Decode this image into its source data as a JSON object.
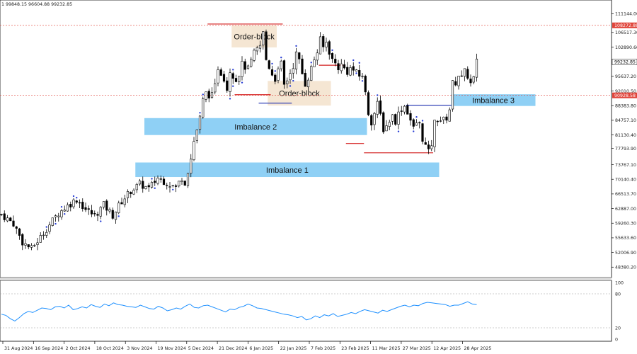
{
  "header": {
    "ohlc_text": "1  99848.15 96604.88 99232.85"
  },
  "chart_data": {
    "type": "candlestick",
    "main_pane": {
      "ylim": [
        46500,
        112800
      ],
      "y_ticks": [
        "111144.00",
        "106517.30",
        "102890.60",
        "95637.20",
        "92010.50",
        "88383.80",
        "84757.10",
        "81130.40",
        "77793.90",
        "73767.10",
        "70140.40",
        "66513.70",
        "62887.00",
        "59260.30",
        "55633.60",
        "52006.90",
        "48380.20"
      ],
      "price_markers": [
        {
          "label": "108272.88",
          "value": 108272.88,
          "color": "#e0443a"
        },
        {
          "label": "99232.85",
          "value": 99232.85,
          "color": "#ffffff"
        },
        {
          "label": "90928.58",
          "value": 90928.58,
          "color": "#e0443a"
        }
      ],
      "dates": [
        "31 Aug 2024",
        "16 Sep 2024",
        "2 Oct 2024",
        "18 Oct 2024",
        "3 Nov 2024",
        "19 Nov 2024",
        "5 Dec 2024",
        "21 Dec 2024",
        "6 Jan 2025",
        "22 Jan 2025",
        "7 Feb 2025",
        "23 Feb 2025",
        "11 Mar 2025",
        "27 Mar 2025",
        "12 Apr 2025",
        "28 Apr 2025"
      ],
      "close_path": [
        [
          0,
          61400
        ],
        [
          4,
          59200
        ],
        [
          7,
          54600
        ],
        [
          10,
          52900
        ],
        [
          13,
          55800
        ],
        [
          16,
          58900
        ],
        [
          19,
          61800
        ],
        [
          22,
          63600
        ],
        [
          25,
          65200
        ],
        [
          28,
          62700
        ],
        [
          31,
          61100
        ],
        [
          34,
          63800
        ],
        [
          37,
          61200
        ],
        [
          40,
          64700
        ],
        [
          43,
          67300
        ],
        [
          46,
          68900
        ],
        [
          49,
          67800
        ],
        [
          52,
          70500
        ],
        [
          55,
          69300
        ],
        [
          58,
          68100
        ],
        [
          60,
          70600
        ],
        [
          61,
          69400
        ],
        [
          63,
          75200
        ],
        [
          64,
          79600
        ],
        [
          66,
          85300
        ],
        [
          67,
          89600
        ],
        [
          68,
          91400
        ],
        [
          70,
          90800
        ],
        [
          71,
          93100
        ],
        [
          72,
          97900
        ],
        [
          74,
          95300
        ],
        [
          75,
          92600
        ],
        [
          76,
          97200
        ],
        [
          78,
          94800
        ],
        [
          79,
          96400
        ],
        [
          80,
          98600
        ],
        [
          82,
          97400
        ],
        [
          84,
          101300
        ],
        [
          86,
          103200
        ],
        [
          87,
          106400
        ],
        [
          88,
          99800
        ],
        [
          90,
          96200
        ],
        [
          91,
          95100
        ],
        [
          93,
          98700
        ],
        [
          94,
          93400
        ],
        [
          95,
          94800
        ],
        [
          97,
          98300
        ],
        [
          98,
          101200
        ],
        [
          99,
          99400
        ],
        [
          100,
          96300
        ],
        [
          101,
          93800
        ],
        [
          102,
          95400
        ],
        [
          104,
          99900
        ],
        [
          105,
          101700
        ],
        [
          106,
          104600
        ],
        [
          107,
          102800
        ],
        [
          108,
          104100
        ],
        [
          109,
          101800
        ],
        [
          110,
          99700
        ],
        [
          112,
          97900
        ],
        [
          113,
          98400
        ],
        [
          115,
          96800
        ],
        [
          116,
          97600
        ],
        [
          117,
          97200
        ],
        [
          118,
          96400
        ],
        [
          119,
          95700
        ],
        [
          120,
          96100
        ],
        [
          121,
          91300
        ],
        [
          122,
          86600
        ],
        [
          123,
          84400
        ],
        [
          124,
          86500
        ],
        [
          125,
          88700
        ],
        [
          126,
          86100
        ],
        [
          127,
          82600
        ],
        [
          128,
          83400
        ],
        [
          129,
          84700
        ],
        [
          130,
          85900
        ],
        [
          131,
          84600
        ],
        [
          132,
          86400
        ],
        [
          133,
          87700
        ],
        [
          134,
          88300
        ],
        [
          135,
          86900
        ],
        [
          136,
          84800
        ],
        [
          137,
          82700
        ],
        [
          138,
          84200
        ],
        [
          139,
          83600
        ],
        [
          140,
          80300
        ],
        [
          141,
          78400
        ],
        [
          142,
          76800
        ],
        [
          143,
          78900
        ],
        [
          144,
          84200
        ],
        [
          145,
          85100
        ],
        [
          146,
          84900
        ],
        [
          147,
          84800
        ],
        [
          148,
          85400
        ],
        [
          149,
          87600
        ],
        [
          150,
          93900
        ],
        [
          151,
          94200
        ],
        [
          152,
          96100
        ],
        [
          153,
          95100
        ],
        [
          154,
          96700
        ],
        [
          155,
          95800
        ],
        [
          156,
          93800
        ],
        [
          157,
          95100
        ],
        [
          158,
          99200
        ]
      ],
      "levels": [
        {
          "name": "order-block-1",
          "label": "Order-block",
          "x0": 77,
          "x1": 92,
          "top": 108300,
          "bottom": 102800,
          "color": "#f5e6d3"
        },
        {
          "name": "order-block-2",
          "label": "Order-block",
          "x0": 89,
          "x1": 110,
          "top": 94500,
          "bottom": 88400,
          "color": "#f5e6d3"
        },
        {
          "name": "imbalance-2",
          "label": "Imbalance 2",
          "x0": 48,
          "x1": 122,
          "top": 85300,
          "bottom": 81100,
          "color": "#8fd0f5"
        },
        {
          "name": "imbalance-1",
          "label": "Imbalance 1",
          "x0": 45,
          "x1": 146,
          "top": 74300,
          "bottom": 70700,
          "color": "#8fd0f5"
        },
        {
          "name": "imbalance-3",
          "label": "Imbalance 3",
          "x0": 150,
          "x1": 178,
          "top": 91200,
          "bottom": 88300,
          "color": "#8fd0f5"
        }
      ]
    },
    "oscillator_pane": {
      "ylim": [
        0,
        100
      ],
      "y_ticks": [
        "100",
        "80",
        "20",
        "0"
      ],
      "values": [
        44,
        42,
        36,
        32,
        38,
        45,
        49,
        47,
        51,
        55,
        54,
        52,
        57,
        58,
        55,
        60,
        52,
        54,
        57,
        55,
        61,
        58,
        56,
        62,
        59,
        64,
        61,
        60,
        58,
        57,
        56,
        60,
        57,
        54,
        53,
        58,
        55,
        50,
        52,
        55,
        53,
        58,
        62,
        56,
        55,
        59,
        60,
        57,
        54,
        51,
        48,
        53,
        52,
        56,
        58,
        62,
        59,
        55,
        54,
        52,
        50,
        48,
        46,
        44,
        43,
        41,
        38,
        40,
        34,
        36,
        41,
        38,
        43,
        41,
        45,
        40,
        42,
        44,
        47,
        45,
        49,
        52,
        50,
        48,
        46,
        51,
        49,
        52,
        55,
        58,
        60,
        57,
        60,
        59,
        63,
        65,
        64,
        63,
        62,
        61,
        58,
        60,
        60,
        63,
        66,
        62,
        61
      ]
    }
  }
}
